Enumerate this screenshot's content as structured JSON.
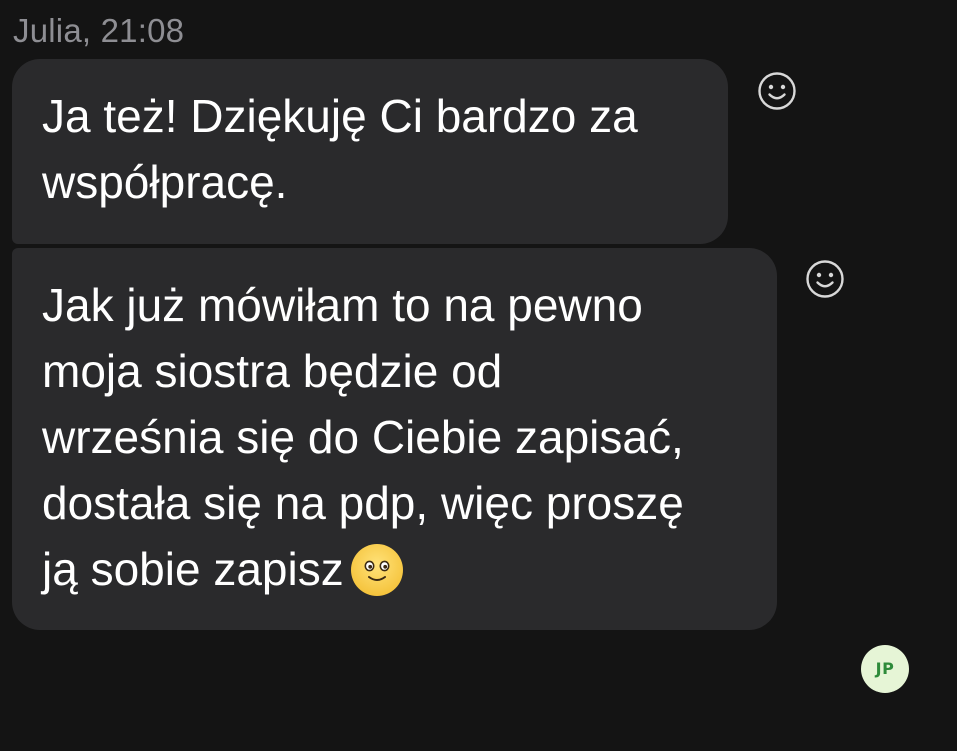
{
  "sender": {
    "name": "Julia",
    "time": "21:08",
    "label": "Julia, 21:08"
  },
  "messages": [
    {
      "text": "Ja też! Dziękuję Ci bardzo za\nwspółpracę.",
      "reaction_icon": "add-reaction-smiley-icon"
    },
    {
      "text": "Jak już mówiłam to na pewno\nmoja siostra będzie od\nwrześnia się do Ciebie zapisać,\ndostała się na pdp, więc proszę\nją sobie zapisz",
      "trailing_emoji": "slightly-smiling-face-emoji",
      "reaction_icon": "add-reaction-smiley-icon"
    }
  ],
  "read_receipt": {
    "initials": "JP",
    "colors": {
      "background": "#e6f5d6",
      "text": "#2e8b3a"
    }
  },
  "colors": {
    "background": "#141414",
    "bubble": "#2a2a2c",
    "sender_text": "#8e8e93",
    "message_text": "#ffffff"
  }
}
